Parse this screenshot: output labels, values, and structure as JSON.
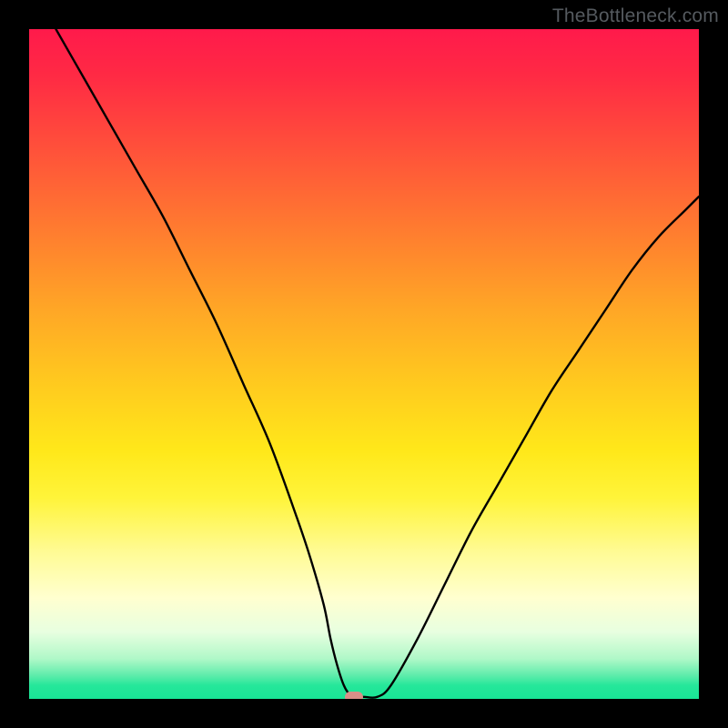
{
  "watermark": "TheBottleneck.com",
  "chart_data": {
    "type": "line",
    "title": "",
    "xlabel": "",
    "ylabel": "",
    "xlim": [
      0,
      100
    ],
    "ylim": [
      0,
      100
    ],
    "grid": false,
    "legend": false,
    "series": [
      {
        "name": "bottleneck-curve",
        "x": [
          4,
          8,
          12,
          16,
          20,
          24,
          28,
          32,
          36,
          40,
          42,
          44,
          45,
          46,
          47,
          48,
          49,
          50,
          52,
          54,
          58,
          62,
          66,
          70,
          74,
          78,
          82,
          86,
          90,
          94,
          98,
          100
        ],
        "y": [
          100,
          93,
          86,
          79,
          72,
          64,
          56,
          47,
          38,
          27,
          21,
          14,
          9,
          5,
          2,
          0.5,
          0.3,
          0.3,
          0.3,
          2,
          9,
          17,
          25,
          32,
          39,
          46,
          52,
          58,
          64,
          69,
          73,
          75
        ]
      }
    ],
    "marker": {
      "x": 48.5,
      "y": 0.3
    },
    "background": {
      "type": "vertical-gradient",
      "stops": [
        {
          "pct": 0,
          "color": "#ff1a4b"
        },
        {
          "pct": 50,
          "color": "#ffd21f"
        },
        {
          "pct": 85,
          "color": "#fffde0"
        },
        {
          "pct": 100,
          "color": "#19e596"
        }
      ]
    }
  }
}
